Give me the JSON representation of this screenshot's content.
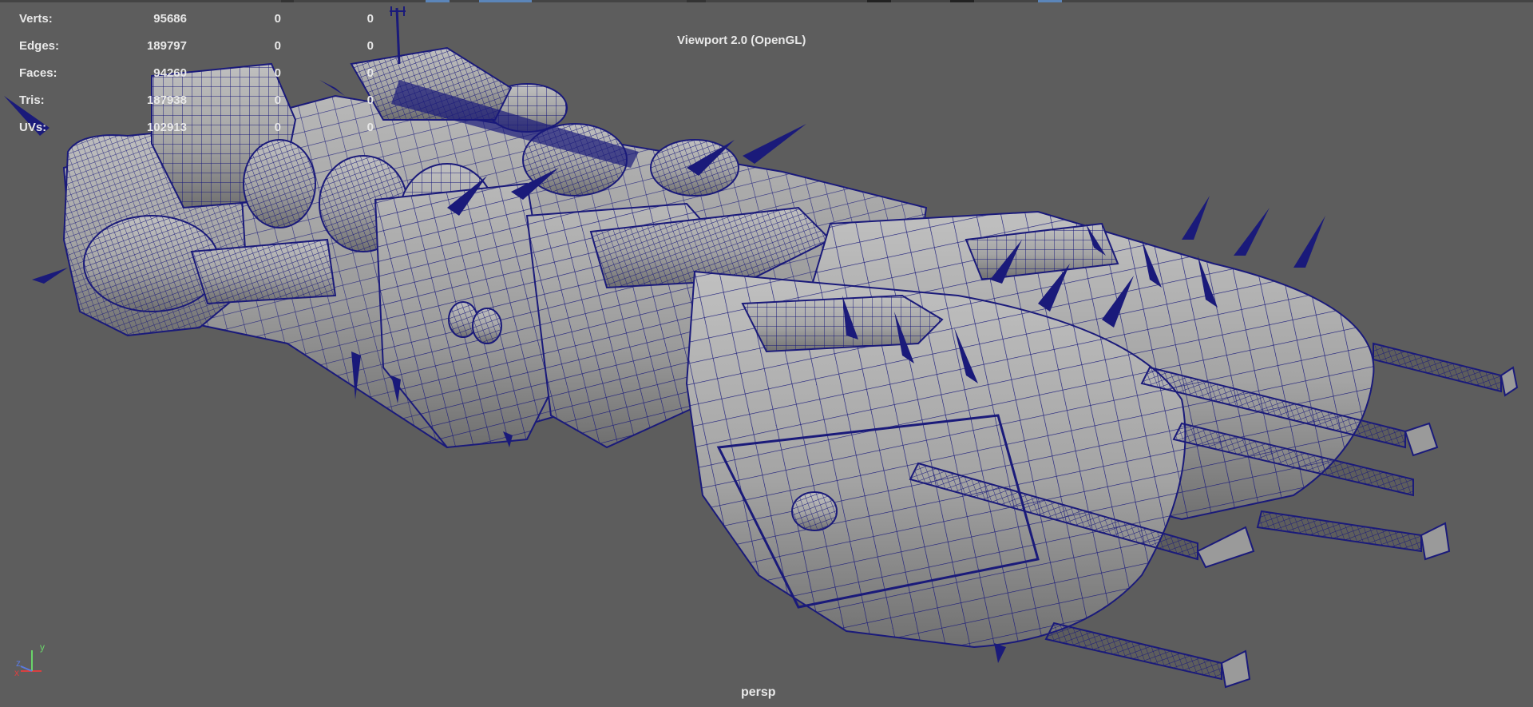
{
  "stats": {
    "rows": [
      {
        "label": "Verts:",
        "value": "95686",
        "selected": "0",
        "component": "0"
      },
      {
        "label": "Edges:",
        "value": "189797",
        "selected": "0",
        "component": "0"
      },
      {
        "label": "Faces:",
        "value": "94260",
        "selected": "0",
        "component": "0"
      },
      {
        "label": "Tris:",
        "value": "187938",
        "selected": "0",
        "component": "0"
      },
      {
        "label": "UVs:",
        "value": "102913",
        "selected": "0",
        "component": "0"
      }
    ]
  },
  "viewport": {
    "renderer": "Viewport 2.0 (OpenGL)",
    "camera": "persp",
    "background_color": "#5d5d5d",
    "wire_color": "#1a1a7a",
    "shade_color": "#9a9a9a"
  },
  "axis": {
    "x_label": "x",
    "y_label": "y",
    "z_label": "z"
  }
}
